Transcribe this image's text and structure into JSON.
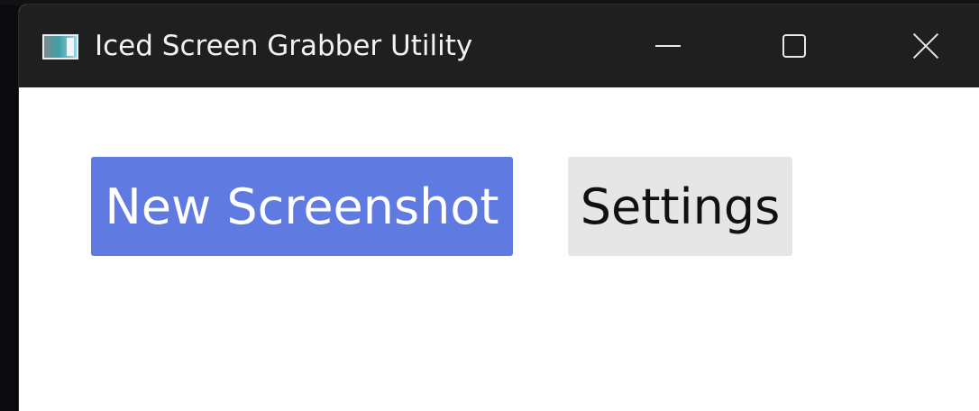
{
  "window": {
    "title": "Iced Screen Grabber Utility",
    "app_icon": "app-window-icon",
    "controls": {
      "minimize_icon": "minimize-icon",
      "maximize_icon": "maximize-icon",
      "close_icon": "close-icon"
    }
  },
  "main": {
    "buttons": {
      "new_screenshot_label": "New Screenshot",
      "settings_label": "Settings"
    }
  },
  "colors": {
    "primary_button_bg": "#5f7be2",
    "secondary_button_bg": "#e6e6e6",
    "titlebar_bg": "#1f1f1f",
    "window_bg": "#ffffff"
  }
}
